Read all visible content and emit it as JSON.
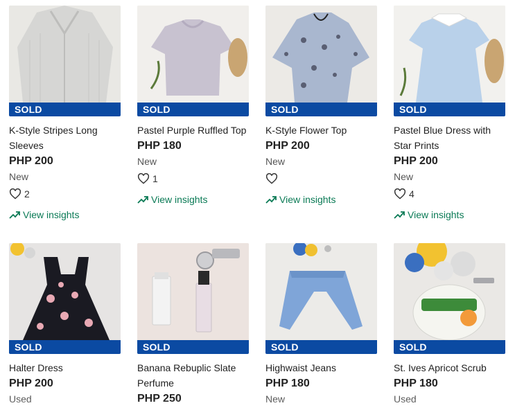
{
  "badges": {
    "sold": "SOLD"
  },
  "colors": {
    "sold_bar": "#0b4aa2",
    "insights": "#0a7a55"
  },
  "listings": [
    {
      "title": "K-Style Stripes Long Sleeves",
      "price": "PHP 200",
      "condition": "New",
      "likes": "2",
      "insights": "View insights"
    },
    {
      "title": "Pastel Purple Ruffled Top",
      "price": "PHP 180",
      "condition": "New",
      "likes": "1",
      "insights": "View insights"
    },
    {
      "title": "K-Style Flower Top",
      "price": "PHP 200",
      "condition": "New",
      "likes": "",
      "insights": "View insights"
    },
    {
      "title": "Pastel Blue Dress with Star Prints",
      "price": "PHP 200",
      "condition": "New",
      "likes": "4",
      "insights": "View insights"
    },
    {
      "title": "Halter Dress",
      "price": "PHP 200",
      "condition": "Used"
    },
    {
      "title": "Banana Rebuplic Slate Perfume",
      "price": "PHP 250",
      "condition": ""
    },
    {
      "title": "Highwaist Jeans",
      "price": "PHP 180",
      "condition": "New"
    },
    {
      "title": "St. Ives Apricot Scrub",
      "price": "PHP 180",
      "condition": "Used"
    }
  ],
  "icons": {
    "like": "heart-outline-icon",
    "insights": "trending-up-icon"
  }
}
